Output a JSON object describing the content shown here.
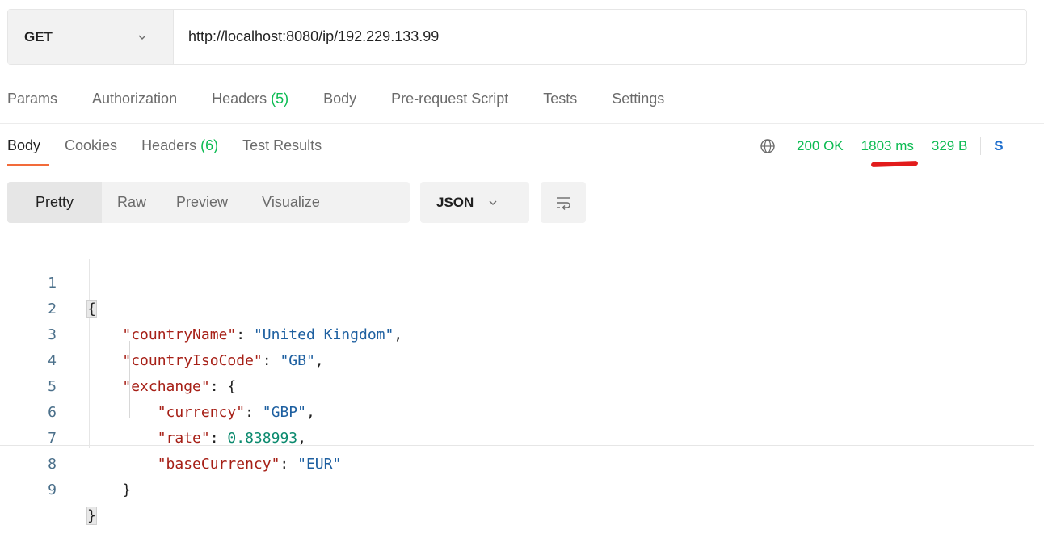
{
  "request": {
    "method": "GET",
    "url": "http://localhost:8080/ip/192.229.133.99"
  },
  "request_tabs": [
    {
      "label": "Params",
      "badge": ""
    },
    {
      "label": "Authorization",
      "badge": ""
    },
    {
      "label": "Headers ",
      "badge": "(5)"
    },
    {
      "label": "Body",
      "badge": ""
    },
    {
      "label": "Pre-request Script",
      "badge": ""
    },
    {
      "label": "Tests",
      "badge": ""
    },
    {
      "label": "Settings",
      "badge": ""
    }
  ],
  "response_tabs": [
    {
      "label": "Body",
      "badge": ""
    },
    {
      "label": "Cookies",
      "badge": ""
    },
    {
      "label": "Headers ",
      "badge": "(6)"
    },
    {
      "label": "Test Results",
      "badge": ""
    }
  ],
  "status": {
    "code": "200 OK",
    "time": "1803 ms",
    "size": "329 B",
    "save_label": "S"
  },
  "format": {
    "modes": [
      "Pretty",
      "Raw",
      "Preview",
      "Visualize"
    ],
    "active_mode": "Pretty",
    "language": "JSON"
  },
  "code_lines": [
    {
      "n": "1"
    },
    {
      "n": "2",
      "k": "\"countryName\"",
      "v": "\"United Kingdom\""
    },
    {
      "n": "3",
      "k": "\"countryIsoCode\"",
      "v": "\"GB\""
    },
    {
      "n": "4",
      "k": "\"exchange\""
    },
    {
      "n": "5",
      "k": "\"currency\"",
      "v": "\"GBP\""
    },
    {
      "n": "6",
      "k": "\"rate\"",
      "v": "0.838993"
    },
    {
      "n": "7",
      "k": "\"baseCurrency\"",
      "v": "\"EUR\""
    },
    {
      "n": "8"
    },
    {
      "n": "9"
    }
  ],
  "colors": {
    "accent_tab": "#f26b3a",
    "status_green": "#0cbb52",
    "annotation_red": "#e21b1b",
    "save_blue": "#1f6fce"
  }
}
